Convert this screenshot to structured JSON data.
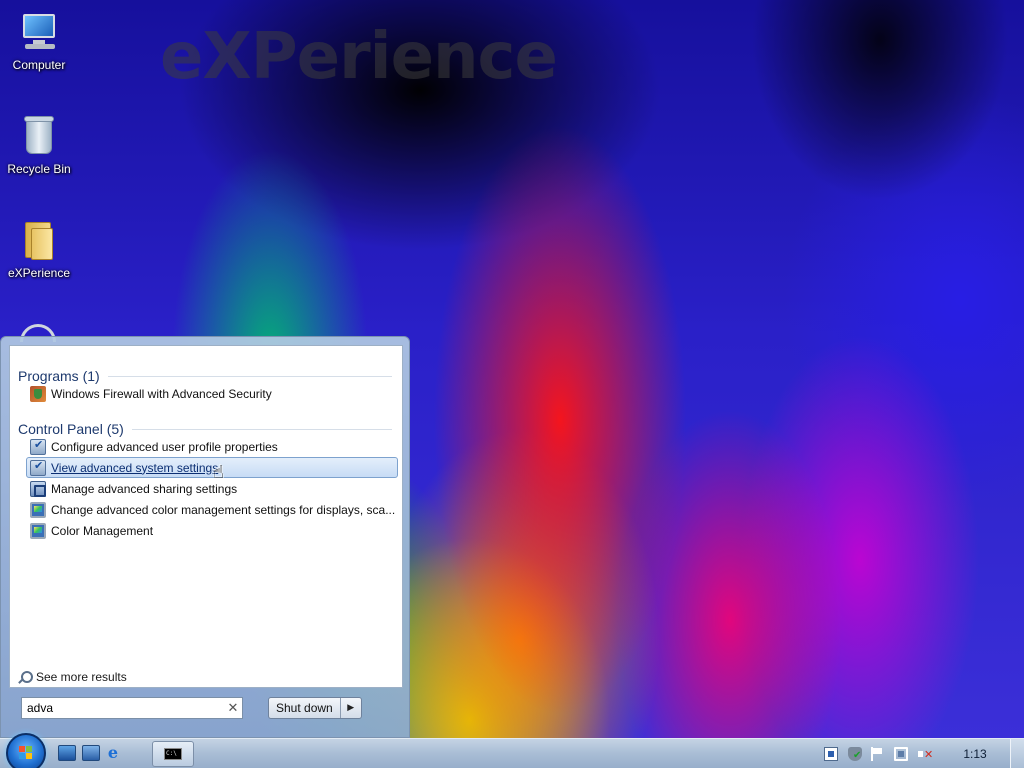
{
  "wallpaper": {
    "brand_text": "eXPerience"
  },
  "desktop_icons": [
    {
      "label": "Computer",
      "icon": "computer-icon"
    },
    {
      "label": "Recycle Bin",
      "icon": "recycle-bin-icon"
    },
    {
      "label": "eXPerience",
      "icon": "folder-icon"
    }
  ],
  "start_menu": {
    "groups": [
      {
        "title": "Programs (1)",
        "items": [
          {
            "label": "Windows Firewall with Advanced Security",
            "icon": "firewall-icon"
          }
        ]
      },
      {
        "title": "Control Panel (5)",
        "items": [
          {
            "label": "Configure advanced user profile properties",
            "icon": "control-panel-icon"
          },
          {
            "label": "View advanced system settings",
            "icon": "control-panel-icon",
            "hovered": true
          },
          {
            "label": "Manage advanced sharing settings",
            "icon": "network-icon"
          },
          {
            "label": "Change advanced color management settings for displays, sca...",
            "icon": "display-icon"
          },
          {
            "label": "Color Management",
            "icon": "display-icon"
          }
        ]
      }
    ],
    "see_more": "See more results",
    "search": {
      "value": "adva",
      "clear_icon": "clear-icon"
    },
    "shutdown": {
      "label": "Shut down",
      "arrow_icon": "arrow-right-icon"
    }
  },
  "taskbar": {
    "start_button_icon": "windows-orb-icon",
    "quick_launch": [
      "show-desktop-icon",
      "switch-windows-icon",
      "internet-explorer-icon"
    ],
    "running": [
      {
        "icon": "command-prompt-icon",
        "text": "C:\\"
      }
    ],
    "tray_icons": [
      "document-icon",
      "security-shield-icon",
      "action-center-flag-icon",
      "network-icon",
      "volume-muted-icon"
    ],
    "clock": "1:13"
  },
  "colors": {
    "menu_group_title": "#1e3a6e",
    "hover_highlight": "#c7dcf5",
    "taskbar": "#a9bdd5"
  }
}
